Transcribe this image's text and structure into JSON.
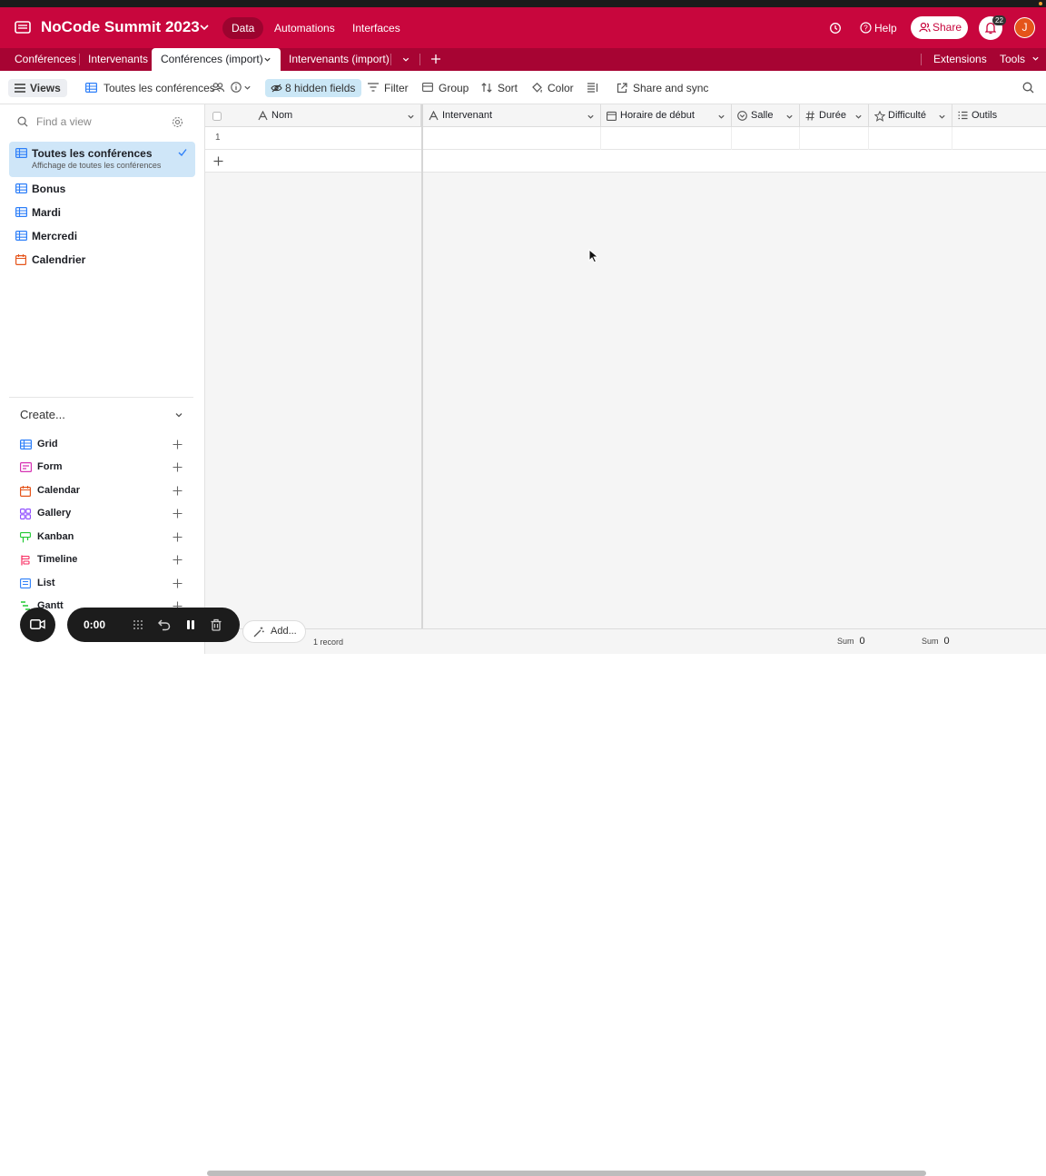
{
  "app": {
    "base_title": "NoCode Summit 2023",
    "nav": [
      "Data",
      "Automations",
      "Interfaces"
    ],
    "help_label": "Help",
    "share_label": "Share",
    "notification_count": "22",
    "avatar_initial": "J",
    "brand_color": "#c8063d"
  },
  "tables": {
    "tabs": [
      "Conférences",
      "Intervenants",
      "Conférences (import)",
      "Intervenants (import)"
    ],
    "active_tab": "Conférences (import)",
    "extensions_label": "Extensions",
    "tools_label": "Tools"
  },
  "viewbar": {
    "views_label": "Views",
    "current_view": "Toutes les conférences",
    "hidden_fields_label": "8 hidden fields",
    "filter_label": "Filter",
    "group_label": "Group",
    "sort_label": "Sort",
    "color_label": "Color",
    "share_sync_label": "Share and sync"
  },
  "sidebar": {
    "find_placeholder": "Find a view",
    "active_view": {
      "label": "Toutes les conférences",
      "subtitle": "Affichage de toutes les conférences"
    },
    "views": [
      "Bonus",
      "Mardi",
      "Mercredi",
      "Calendrier"
    ],
    "create_title": "Create...",
    "create_items": [
      "Grid",
      "Form",
      "Calendar",
      "Gallery",
      "Kanban",
      "Timeline",
      "List",
      "Gantt"
    ]
  },
  "grid": {
    "columns": [
      "Nom",
      "Intervenant",
      "Horaire de début",
      "Salle",
      "Durée",
      "Difficulté",
      "Outils"
    ],
    "rows": [
      "1"
    ],
    "record_count": "1 record",
    "sum_label": "Sum",
    "sums": [
      "0",
      "0"
    ],
    "add_label": "Add..."
  },
  "recorder": {
    "time": "0:00"
  }
}
